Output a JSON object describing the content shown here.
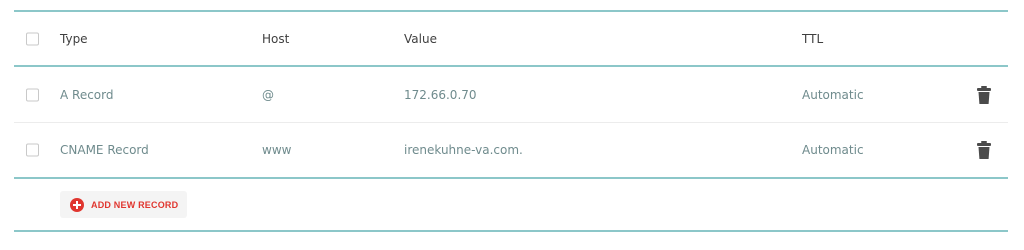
{
  "table": {
    "headers": {
      "type": "Type",
      "host": "Host",
      "value": "Value",
      "ttl": "TTL"
    },
    "rows": [
      {
        "type": "A Record",
        "host": "@",
        "value": "172.66.0.70",
        "ttl": "Automatic"
      },
      {
        "type": "CNAME Record",
        "host": "www",
        "value": "irenekuhne-va.com.",
        "ttl": "Automatic"
      }
    ]
  },
  "actions": {
    "add_record_label": "ADD NEW RECORD"
  },
  "icons": {
    "delete": "trash-icon",
    "add": "plus-circle-icon"
  },
  "colors": {
    "accent_rule": "#8cc7c9",
    "danger": "#e0362f",
    "text_muted": "#6f8b8d"
  }
}
